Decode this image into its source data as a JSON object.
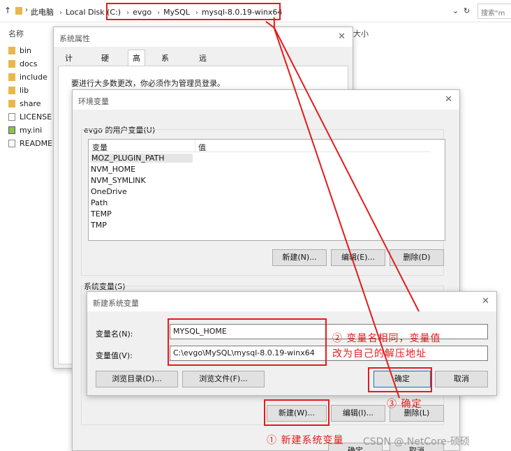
{
  "explorer": {
    "breadcrumbs": [
      "此电脑",
      "Local Disk (C:)",
      "evgo",
      "MySQL",
      "mysql-8.0.19-winx64"
    ],
    "search_placeholder": "搜索\"m",
    "col_name": "名称",
    "col_size": "大小",
    "files": [
      {
        "name": "bin",
        "type": "folder"
      },
      {
        "name": "docs",
        "type": "folder"
      },
      {
        "name": "include",
        "type": "folder"
      },
      {
        "name": "lib",
        "type": "folder"
      },
      {
        "name": "share",
        "type": "folder"
      },
      {
        "name": "LICENSE",
        "type": "file"
      },
      {
        "name": "my.ini",
        "type": "ini"
      },
      {
        "name": "README",
        "type": "file"
      }
    ]
  },
  "sysprops": {
    "title": "系统属性",
    "tabs": [
      "计算机名",
      "硬件",
      "高级",
      "系统保护",
      "远程"
    ],
    "active_tab": "高级",
    "notice": "要进行大多数更改，你必须作为管理员登录。"
  },
  "envvars": {
    "title": "环境变量",
    "user_group_label": "evgo 的用户变量(U)",
    "col_var": "变量",
    "col_value": "值",
    "user_vars": [
      "MOZ_PLUGIN_PATH",
      "NVM_HOME",
      "NVM_SYMLINK",
      "OneDrive",
      "Path",
      "TEMP",
      "TMP"
    ],
    "user_buttons": {
      "new": "新建(N)...",
      "edit": "编辑(E)...",
      "delete": "删除(D)"
    },
    "sys_group_label": "系统变量(S)",
    "sys_buttons": {
      "new": "新建(W)...",
      "edit": "编辑(I)...",
      "delete": "删除(L)"
    },
    "ok": "确定",
    "cancel": "取消"
  },
  "newvar": {
    "title": "新建系统变量",
    "name_label": "变量名(N):",
    "name_value": "MYSQL_HOME",
    "value_label": "变量值(V):",
    "value_value": "C:\\evgo\\MySQL\\mysql-8.0.19-winx64",
    "browse_dir": "浏览目录(D)...",
    "browse_file": "浏览文件(F)...",
    "ok": "确定",
    "cancel": "取消"
  },
  "annotations": {
    "step1": "① 新建系统变量",
    "step2_line1": "② 变量名相同，变量值",
    "step2_line2": "改为自己的解压地址",
    "step3": "③ 确定",
    "color": "#e31b1b"
  },
  "watermark": "CSDN @.NetCore-硕硕"
}
